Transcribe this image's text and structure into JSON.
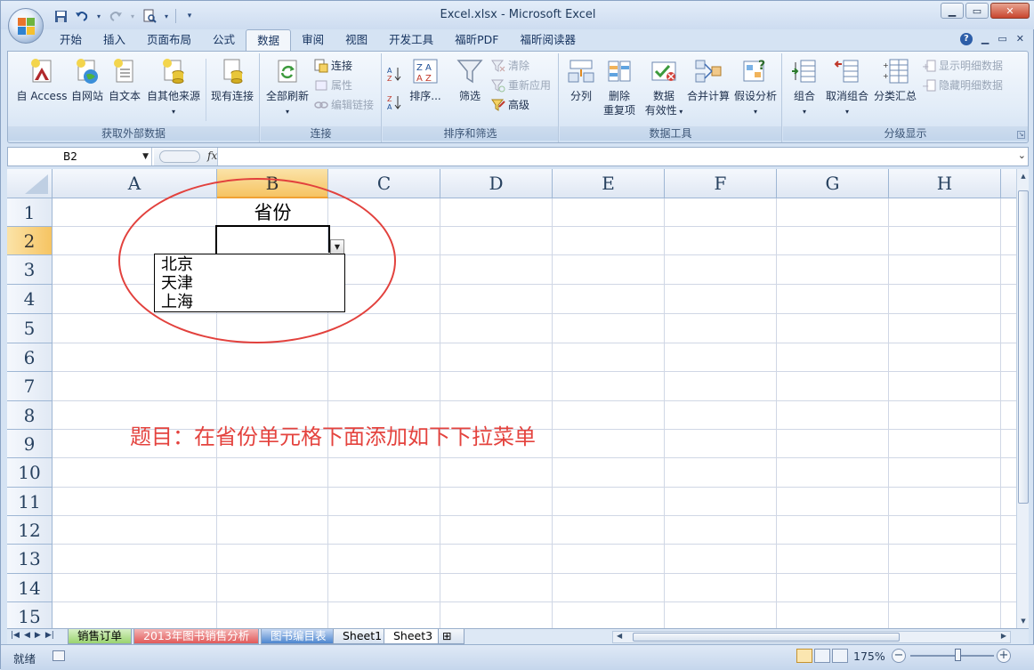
{
  "window": {
    "title": "Excel.xlsx - Microsoft Excel"
  },
  "ribbon_tabs": [
    "开始",
    "插入",
    "页面布局",
    "公式",
    "数据",
    "审阅",
    "视图",
    "开发工具",
    "福昕PDF",
    "福昕阅读器"
  ],
  "active_tab": "数据",
  "ribbon": {
    "get_external": {
      "label": "获取外部数据",
      "access": "自 Access",
      "web": "自网站",
      "text": "自文本",
      "other": "自其他来源",
      "existing": "现有连接"
    },
    "connections": {
      "label": "连接",
      "refresh_all": "全部刷新",
      "connections": "连接",
      "properties": "属性",
      "edit_links": "编辑链接"
    },
    "sort_filter": {
      "label": "排序和筛选",
      "sort": "排序...",
      "filter": "筛选",
      "clear": "清除",
      "reapply": "重新应用",
      "advanced": "高级"
    },
    "data_tools": {
      "label": "数据工具",
      "split": "分列",
      "remove_dup_1": "删除",
      "remove_dup_2": "重复项",
      "validation_1": "数据",
      "validation_2": "有效性",
      "consolidate": "合并计算",
      "whatif": "假设分析"
    },
    "outline": {
      "label": "分级显示",
      "group": "组合",
      "ungroup": "取消组合",
      "subtotal": "分类汇总",
      "show_detail": "显示明细数据",
      "hide_detail": "隐藏明细数据"
    }
  },
  "formula_bar": {
    "name_box": "B2",
    "fx": "fx",
    "formula": ""
  },
  "columns": [
    "A",
    "B",
    "C",
    "D",
    "E",
    "F",
    "G",
    "H"
  ],
  "rows": [
    "1",
    "2",
    "3",
    "4",
    "5",
    "6",
    "7",
    "8",
    "9",
    "10",
    "11",
    "12",
    "13",
    "14",
    "15"
  ],
  "cells": {
    "B1": "省份",
    "B2": ""
  },
  "dropdown_options": [
    "北京",
    "天津",
    "上海"
  ],
  "annotation": "题目：在省份单元格下面添加如下下拉菜单",
  "sheets": [
    "销售订单",
    "2013年图书销售分析",
    "图书编目表",
    "Sheet1",
    "Sheet3"
  ],
  "active_sheet": "Sheet3",
  "status": {
    "ready": "就绪",
    "zoom": "175%"
  },
  "colors": {
    "accent_red": "#e4433e",
    "selected_header": "#f6c462"
  }
}
